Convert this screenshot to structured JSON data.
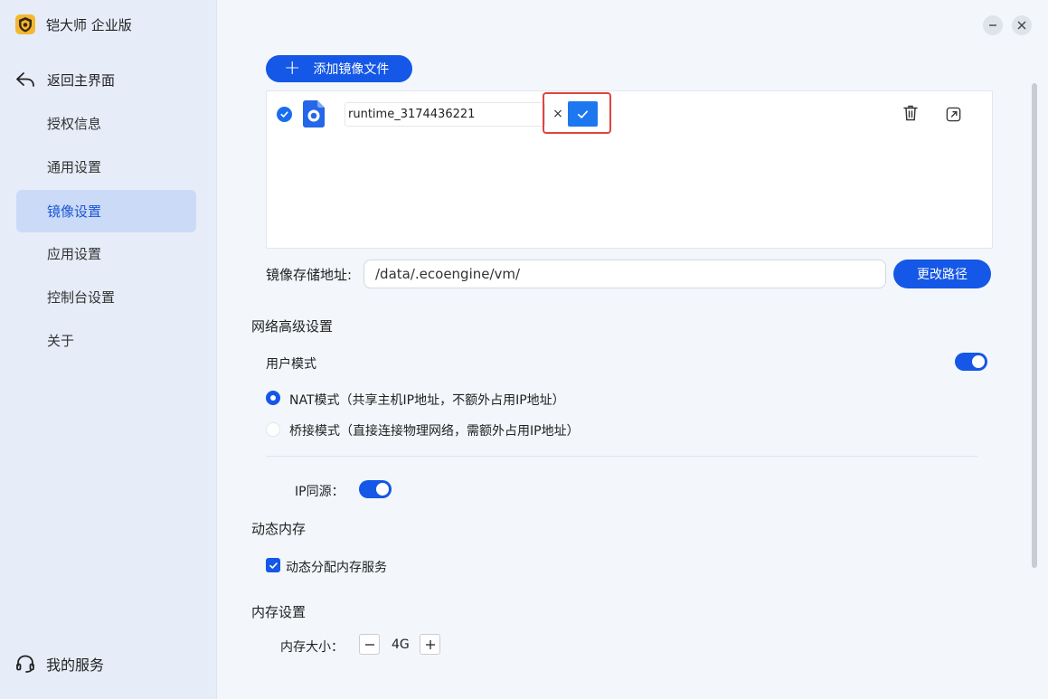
{
  "app": {
    "name": "铠大师 企业版"
  },
  "sidebar": {
    "back_label": "返回主界面",
    "items": [
      {
        "label": "授权信息"
      },
      {
        "label": "通用设置"
      },
      {
        "label": "镜像设置"
      },
      {
        "label": "应用设置"
      },
      {
        "label": "控制台设置"
      },
      {
        "label": "关于"
      }
    ],
    "active_item": "镜像设置",
    "service_label": "我的服务"
  },
  "images": {
    "add_button_label": "添加镜像文件",
    "list": [
      {
        "name_value": "runtime_3174436221",
        "selected": true
      }
    ],
    "cancel_glyph": "×"
  },
  "storage": {
    "label": "镜像存储地址:",
    "path_value": "/data/.ecoengine/vm/",
    "change_button_label": "更改路径"
  },
  "network": {
    "title": "网络高级设置",
    "user_mode_label": "用户模式",
    "user_mode_on": true,
    "options": [
      {
        "label": "NAT模式（共享主机IP地址，不额外占用IP地址）",
        "selected": true
      },
      {
        "label": "桥接模式（直接连接物理网络，需额外占用IP地址）",
        "selected": false
      }
    ],
    "ip_same_source_label": "IP同源：",
    "ip_same_source_on": true
  },
  "dynamic_memory": {
    "title": "动态内存",
    "checkbox_label": "动态分配内存服务",
    "checked": true
  },
  "memory": {
    "title": "内存设置",
    "size_label": "内存大小：",
    "size_value": "4G"
  },
  "colors": {
    "accent": "#1557e6",
    "highlight": "#e0443e",
    "sidebar_bg": "#e6edf9",
    "active_item_bg": "#cbdaf6"
  }
}
